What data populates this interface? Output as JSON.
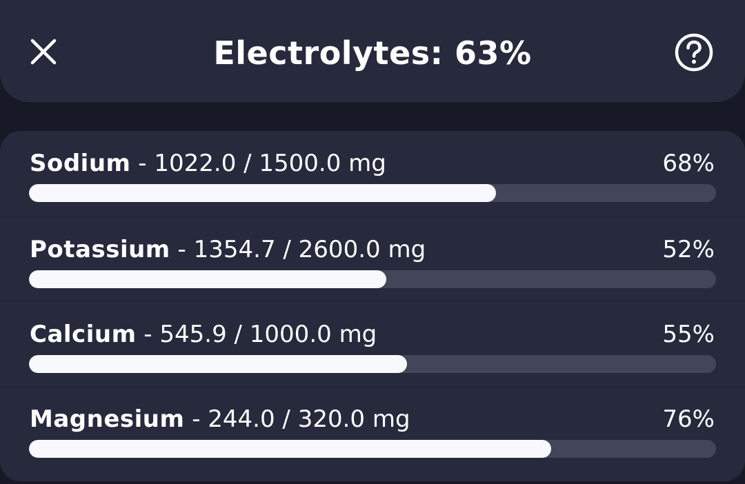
{
  "header": {
    "title": "Electrolytes: 63%",
    "close_icon": "close-icon",
    "help_icon": "help-circle-icon"
  },
  "nutrients": [
    {
      "name": "Sodium",
      "detail": " - 1022.0 / 1500.0 mg",
      "percent_label": "68%",
      "percent": 68
    },
    {
      "name": "Potassium",
      "detail": " - 1354.7 / 2600.0 mg",
      "percent_label": "52%",
      "percent": 52
    },
    {
      "name": "Calcium",
      "detail": " - 545.9 / 1000.0 mg",
      "percent_label": "55%",
      "percent": 55
    },
    {
      "name": "Magnesium",
      "detail": " - 244.0 / 320.0 mg",
      "percent_label": "76%",
      "percent": 76
    }
  ],
  "colors": {
    "background": "#171a26",
    "surface": "#262a3c",
    "track": "#434658",
    "fill": "#f8f9fd",
    "text": "#ffffff"
  }
}
